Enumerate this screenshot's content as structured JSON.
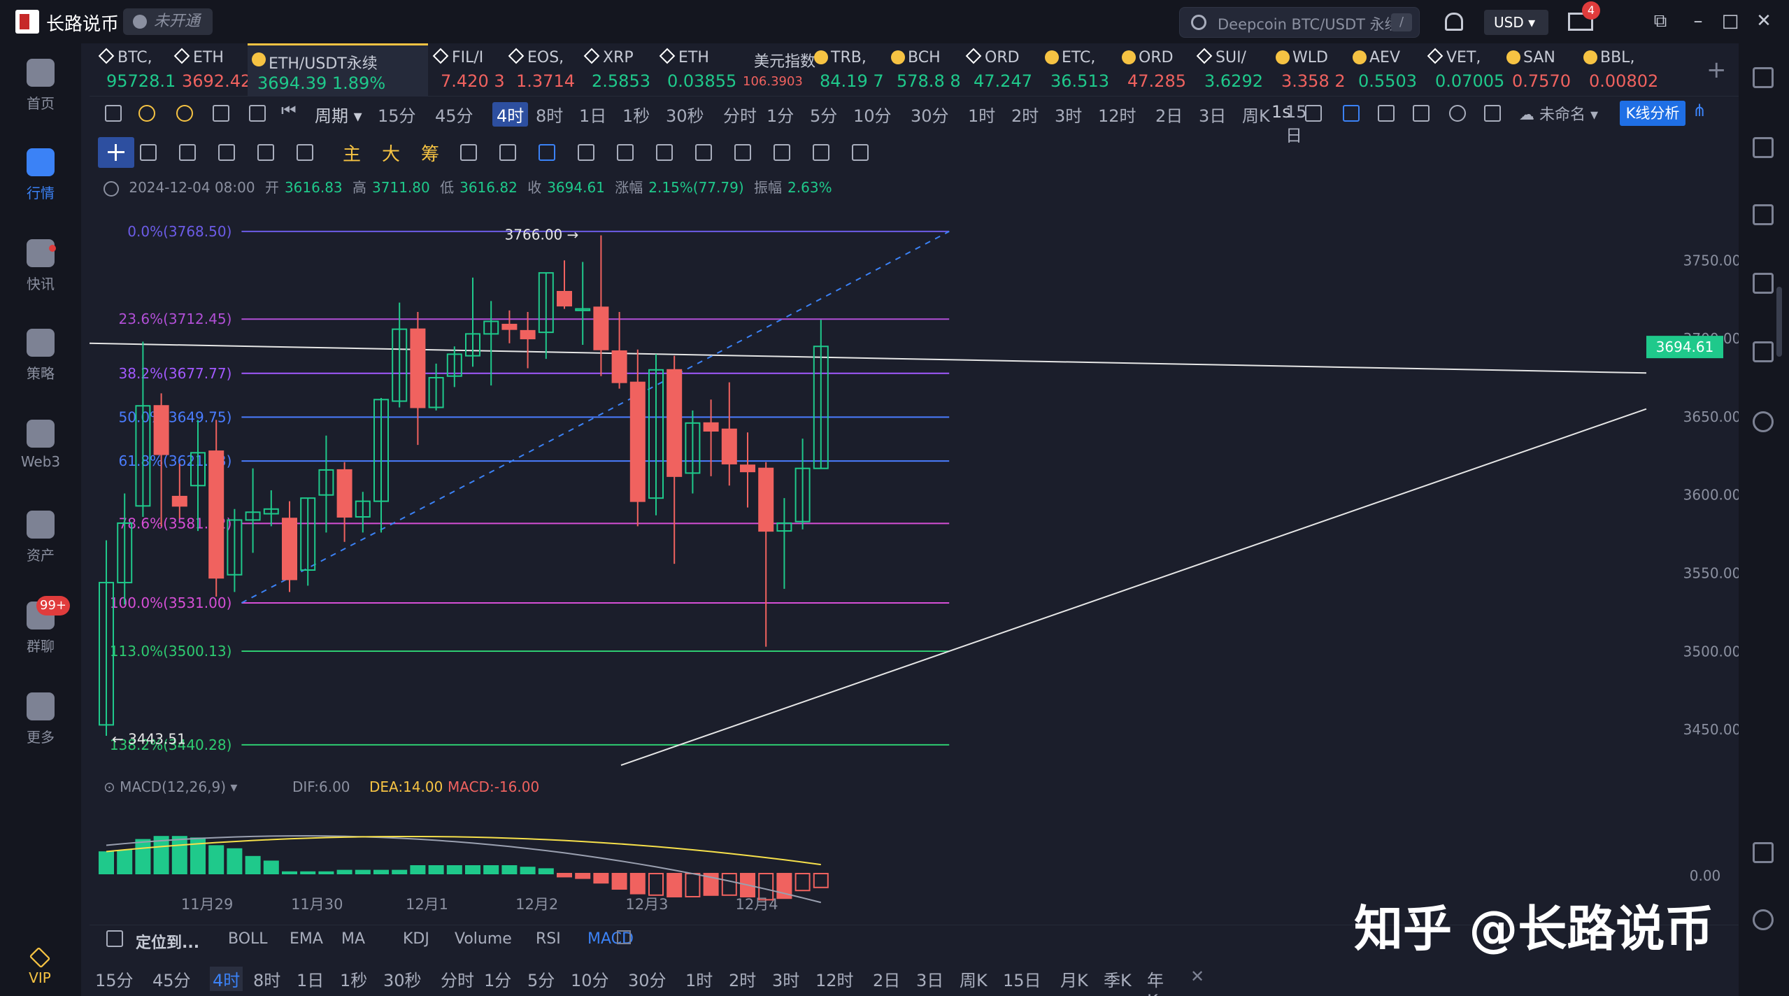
{
  "app": {
    "title": "长路说币",
    "badge": "未开通"
  },
  "search": {
    "placeholder": "Deepcoin BTC/USDT 永续",
    "shortcut": "/"
  },
  "header": {
    "currency": "USD",
    "mail_count": "4"
  },
  "leftnav": {
    "items": [
      {
        "label": "首页"
      },
      {
        "label": "行情"
      },
      {
        "label": "快讯"
      },
      {
        "label": "策略"
      },
      {
        "label": "Web3"
      },
      {
        "label": "资产"
      },
      {
        "label": "群聊"
      },
      {
        "label": "更多"
      }
    ],
    "chat_badge": "99+",
    "vip": "VIP"
  },
  "tickers": [
    {
      "name": "BTC,",
      "price": "95728.1",
      "color": "#1fc98b"
    },
    {
      "name": "ETH",
      "price": "3692.42",
      "color": "#f0625f"
    },
    {
      "name": "ETH/USDT永续",
      "price": "3694.39",
      "change": "1.89%",
      "color": "#1fc98b"
    },
    {
      "name": "FIL/I",
      "price": "7.420 3",
      "color": "#f0625f"
    },
    {
      "name": "EOS,",
      "price": "1.3714",
      "color": "#f0625f"
    },
    {
      "name": "XRP",
      "price": "2.5853",
      "color": "#1fc98b"
    },
    {
      "name": "ETH",
      "price": "0.03855",
      "color": "#1fc98b"
    },
    {
      "name": "美元指数",
      "price": "106.3903",
      "color": "#f0625f"
    },
    {
      "name": "TRB,",
      "price": "84.19 7",
      "color": "#1fc98b"
    },
    {
      "name": "BCH",
      "price": "578.8 8",
      "color": "#1fc98b"
    },
    {
      "name": "ORD",
      "price": "47.247",
      "color": "#1fc98b"
    },
    {
      "name": "ETC,",
      "price": "36.513",
      "color": "#1fc98b"
    },
    {
      "name": "ORD",
      "price": "47.285",
      "color": "#f0625f"
    },
    {
      "name": "SUI/",
      "price": "3.6292",
      "color": "#1fc98b"
    },
    {
      "name": "WLD",
      "price": "3.358 2",
      "color": "#f0625f"
    },
    {
      "name": "AEV",
      "price": "0.5503",
      "color": "#1fc98b"
    },
    {
      "name": "VET,",
      "price": "0.07005",
      "color": "#1fc98b"
    },
    {
      "name": "SAN",
      "price": "0.7570",
      "color": "#f0625f"
    },
    {
      "name": "BBL,",
      "price": "0.00802",
      "color": "#f0625f"
    }
  ],
  "toolbar": {
    "period_label": "周期",
    "timeframes": [
      "15分",
      "45分",
      "4时",
      "8时",
      "1日",
      "1秒",
      "30秒",
      "分时",
      "1分",
      "5分",
      "10分",
      "30分",
      "1时",
      "2时",
      "3时",
      "12时",
      "2日",
      "3日",
      "周K",
      "15日"
    ],
    "selected_tf": "4时",
    "interval": "1s",
    "layout_name": "未命名",
    "kline_btn": "K线分析",
    "drawing_labels": [
      "主",
      "大",
      "筹"
    ]
  },
  "ohlc": {
    "time": "2024-12-04 08:00",
    "open_label": "开",
    "open": "3616.83",
    "high_label": "高",
    "high": "3711.80",
    "low_label": "低",
    "low": "3616.82",
    "close_label": "收",
    "close": "3694.61",
    "change_label": "涨幅",
    "change": "2.15%(77.79)",
    "amp_label": "振幅",
    "amp": "2.63%"
  },
  "chart_data": {
    "type": "candlestick",
    "price_axis": {
      "ticks": [
        3750,
        3700,
        3650,
        3600,
        3550,
        3500,
        3450
      ],
      "labels": [
        "3750.00",
        "3700.00",
        "3650.00",
        "3600.00",
        "3550.00",
        "3500.00",
        "3450.00"
      ],
      "range": [
        3425,
        3785
      ]
    },
    "time_axis": [
      "11月29",
      "11月30",
      "12月1",
      "12月2",
      "12月3",
      "12月4"
    ],
    "current_price": "3694.61",
    "high_marker": "3766.00",
    "low_marker": "3443.51",
    "candles": [
      {
        "o": 3453,
        "h": 3571,
        "l": 3446,
        "c": 3544
      },
      {
        "o": 3544,
        "h": 3601,
        "l": 3530,
        "c": 3582
      },
      {
        "o": 3593,
        "h": 3698,
        "l": 3586,
        "c": 3657
      },
      {
        "o": 3657,
        "h": 3665,
        "l": 3580,
        "c": 3626
      },
      {
        "o": 3599,
        "h": 3620,
        "l": 3585,
        "c": 3593
      },
      {
        "o": 3606,
        "h": 3648,
        "l": 3577,
        "c": 3627
      },
      {
        "o": 3628,
        "h": 3648,
        "l": 3535,
        "c": 3547
      },
      {
        "o": 3549,
        "h": 3591,
        "l": 3538,
        "c": 3584
      },
      {
        "o": 3584,
        "h": 3617,
        "l": 3563,
        "c": 3589
      },
      {
        "o": 3588,
        "h": 3603,
        "l": 3580,
        "c": 3591
      },
      {
        "o": 3585,
        "h": 3596,
        "l": 3538,
        "c": 3546
      },
      {
        "o": 3552,
        "h": 3598,
        "l": 3542,
        "c": 3598
      },
      {
        "o": 3600,
        "h": 3638,
        "l": 3576,
        "c": 3616
      },
      {
        "o": 3616,
        "h": 3621,
        "l": 3570,
        "c": 3586
      },
      {
        "o": 3586,
        "h": 3602,
        "l": 3576,
        "c": 3596
      },
      {
        "o": 3596,
        "h": 3662,
        "l": 3576,
        "c": 3661
      },
      {
        "o": 3660,
        "h": 3723,
        "l": 3656,
        "c": 3706
      },
      {
        "o": 3706,
        "h": 3717,
        "l": 3632,
        "c": 3656
      },
      {
        "o": 3656,
        "h": 3684,
        "l": 3654,
        "c": 3675
      },
      {
        "o": 3676,
        "h": 3695,
        "l": 3669,
        "c": 3690
      },
      {
        "o": 3689,
        "h": 3739,
        "l": 3682,
        "c": 3703
      },
      {
        "o": 3703,
        "h": 3724,
        "l": 3670,
        "c": 3711
      },
      {
        "o": 3709,
        "h": 3718,
        "l": 3697,
        "c": 3706
      },
      {
        "o": 3705,
        "h": 3717,
        "l": 3681,
        "c": 3700
      },
      {
        "o": 3704,
        "h": 3742,
        "l": 3687,
        "c": 3742
      },
      {
        "o": 3730,
        "h": 3750,
        "l": 3719,
        "c": 3721
      },
      {
        "o": 3718,
        "h": 3749,
        "l": 3696,
        "c": 3719
      },
      {
        "o": 3720,
        "h": 3766,
        "l": 3676,
        "c": 3693
      },
      {
        "o": 3692,
        "h": 3717,
        "l": 3668,
        "c": 3672
      },
      {
        "o": 3672,
        "h": 3693,
        "l": 3580,
        "c": 3596
      },
      {
        "o": 3598,
        "h": 3690,
        "l": 3587,
        "c": 3680
      },
      {
        "o": 3680,
        "h": 3689,
        "l": 3556,
        "c": 3612
      },
      {
        "o": 3614,
        "h": 3654,
        "l": 3601,
        "c": 3646
      },
      {
        "o": 3646,
        "h": 3661,
        "l": 3612,
        "c": 3641
      },
      {
        "o": 3642,
        "h": 3672,
        "l": 3606,
        "c": 3620
      },
      {
        "o": 3619,
        "h": 3640,
        "l": 3592,
        "c": 3615
      },
      {
        "o": 3617,
        "h": 3621,
        "l": 3503,
        "c": 3577
      },
      {
        "o": 3577,
        "h": 3598,
        "l": 3540,
        "c": 3582
      },
      {
        "o": 3583,
        "h": 3636,
        "l": 3578,
        "c": 3617
      },
      {
        "o": 3617,
        "h": 3712,
        "l": 3617,
        "c": 3695
      }
    ],
    "fib_levels": [
      {
        "label": "0.0%(3768.50)",
        "value": 3768.5,
        "color": "#6c5ce7"
      },
      {
        "label": "23.6%(3712.45)",
        "value": 3712.45,
        "color": "#b14fd6"
      },
      {
        "label": "38.2%(3677.77)",
        "value": 3677.77,
        "color": "#a259ff"
      },
      {
        "label": "50.0%(3649.75)",
        "value": 3649.75,
        "color": "#4a7dff"
      },
      {
        "label": "61.8%(3621.73)",
        "value": 3621.73,
        "color": "#4a7dff"
      },
      {
        "label": "78.6%(3581.82)",
        "value": 3581.82,
        "color": "#d64fd6"
      },
      {
        "label": "100.0%(3531.00)",
        "value": 3531,
        "color": "#d64fd6"
      },
      {
        "label": "113.0%(3500.13)",
        "value": 3500.13,
        "color": "#2ecc71"
      },
      {
        "label": "138.2%(3440.28)",
        "value": 3440.28,
        "color": "#2ecc71"
      }
    ],
    "macd": {
      "label": "MACD(12,26,9)",
      "dif": "DIF:6.00",
      "dea": "DEA:14.00",
      "macd_val": "MACD:-16.00",
      "axis_label": "0.00",
      "histogram": [
        14,
        15,
        22,
        24,
        24,
        23,
        18,
        16,
        11,
        8,
        1,
        1,
        1,
        2,
        2,
        2,
        2,
        5,
        5,
        5,
        5,
        5,
        5,
        4,
        3,
        -2,
        -3,
        -6,
        -10,
        -13,
        -14,
        -15,
        -15,
        -14,
        -14,
        -15,
        -17,
        -16,
        -11,
        -9
      ]
    }
  },
  "indicators": {
    "locate": "定位到...",
    "items": [
      "BOLL",
      "EMA",
      "MA",
      "KDJ",
      "Volume",
      "RSI",
      "MACD"
    ],
    "selected": "MACD"
  },
  "bottom_tf": [
    "15分",
    "45分",
    "4时",
    "8时",
    "1日",
    "1秒",
    "30秒",
    "分时",
    "1分",
    "5分",
    "10分",
    "30分",
    "1时",
    "2时",
    "3时",
    "12时",
    "2日",
    "3日",
    "周K",
    "15日",
    "月K",
    "季K",
    "年K"
  ],
  "watermark": "知乎 @长路说币"
}
